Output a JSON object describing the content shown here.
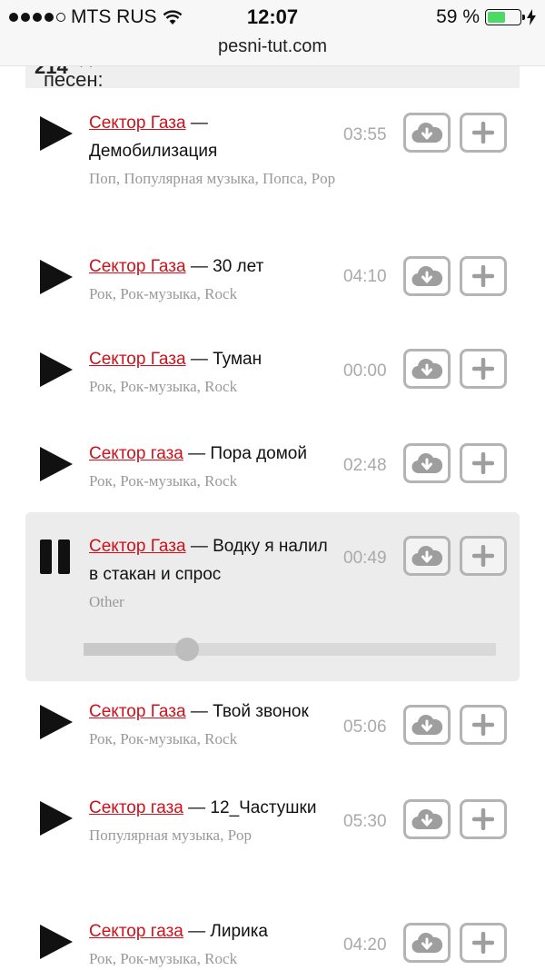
{
  "status_bar": {
    "carrier": "MTS RUS",
    "time": "12:07",
    "battery_label": "59 %",
    "battery_level": 0.59,
    "battery_color": "#4cd964",
    "icons": [
      "signal-dots-icon",
      "wifi-icon",
      "battery-icon",
      "charging-icon"
    ]
  },
  "browser": {
    "url": "pesni-tut.com"
  },
  "results": {
    "label": "Найдено песен:",
    "count": "214"
  },
  "songs": [
    {
      "artist": "Сектор Газа",
      "title": "— Демобилизация",
      "genres": "Поп, Популярная музыка, Попса, Pop",
      "duration": "03:55",
      "state": "play"
    },
    {
      "artist": "Сектор Газа",
      "title": "— 30 лет",
      "genres": "Рок, Рок-музыка, Rock",
      "duration": "04:10",
      "state": "play"
    },
    {
      "artist": "Сектор Газа",
      "title": "— Туман",
      "genres": "Рок, Рок-музыка, Rock",
      "duration": "00:00",
      "state": "play"
    },
    {
      "artist": "Сектор газа",
      "title": "— Пора домой",
      "genres": "Рок, Рок-музыка, Rock",
      "duration": "02:48",
      "state": "play"
    },
    {
      "artist": "Сектор Газа",
      "title": "— Водку я налил в стакан и спрос",
      "genres": "Other",
      "duration": "00:49",
      "state": "pause",
      "progress": 0.25
    },
    {
      "artist": "Сектор Газа",
      "title": "— Твой звонок",
      "genres": "Рок, Рок-музыка, Rock",
      "duration": "05:06",
      "state": "play"
    },
    {
      "artist": "Сектор газа",
      "title": "— 12_Частушки",
      "genres": "Популярная музыка, Pop",
      "duration": "05:30",
      "state": "play"
    },
    {
      "artist": "Сектор газа",
      "title": "— Лирика",
      "genres": "Рок, Рок-музыка, Rock",
      "duration": "04:20",
      "state": "play"
    }
  ],
  "colors": {
    "artist_link": "#d0101a",
    "muted": "#999999",
    "active_row": "#ececec"
  }
}
